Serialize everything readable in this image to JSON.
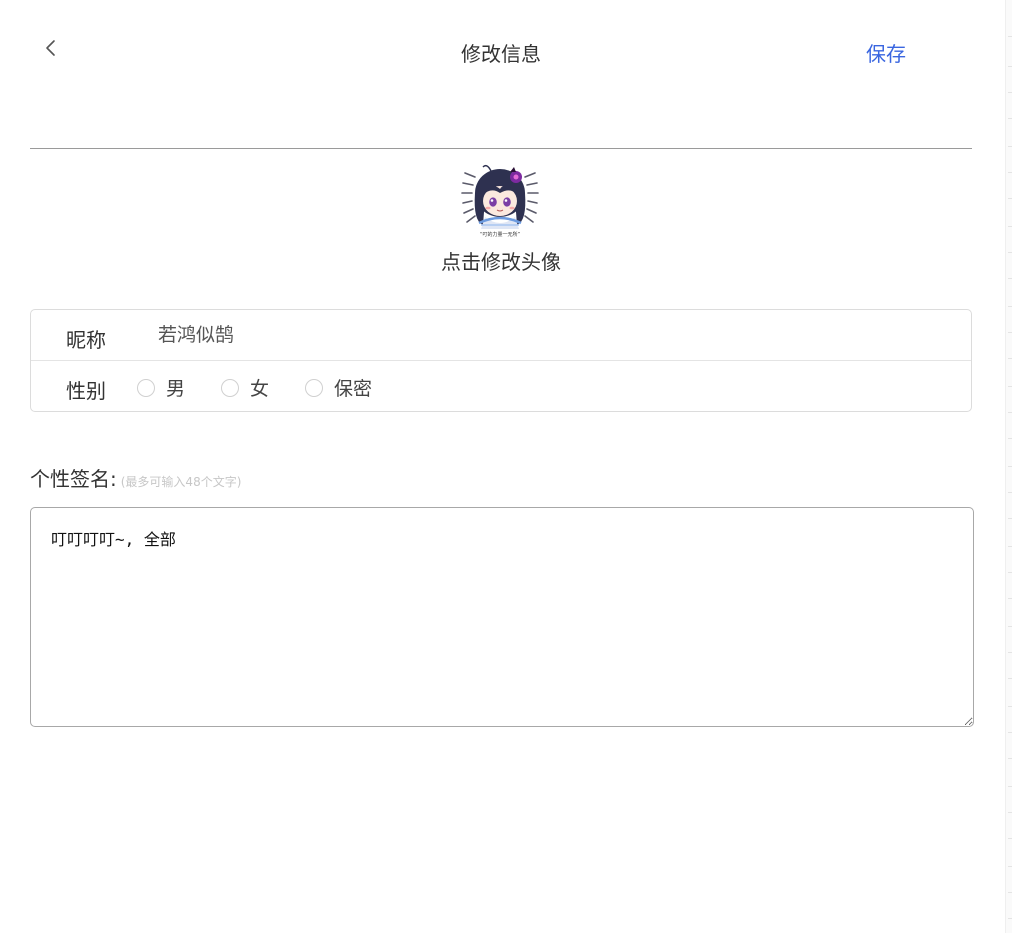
{
  "header": {
    "title": "修改信息",
    "save_label": "保存"
  },
  "avatar": {
    "caption": "点击修改头像",
    "sticker_text": "“叮的力量一无所”"
  },
  "form": {
    "nickname_label": "昵称",
    "nickname_value": "若鸿似鹄",
    "gender_label": "性别",
    "gender_options": [
      "男",
      "女",
      "保密"
    ]
  },
  "signature": {
    "label": "个性签名:",
    "hint": "(最多可输入48个文字)",
    "value": "叮叮叮叮~, 全部"
  },
  "colors": {
    "accent": "#3a66e0",
    "text": "#333333",
    "hint": "#c7c7c7"
  }
}
